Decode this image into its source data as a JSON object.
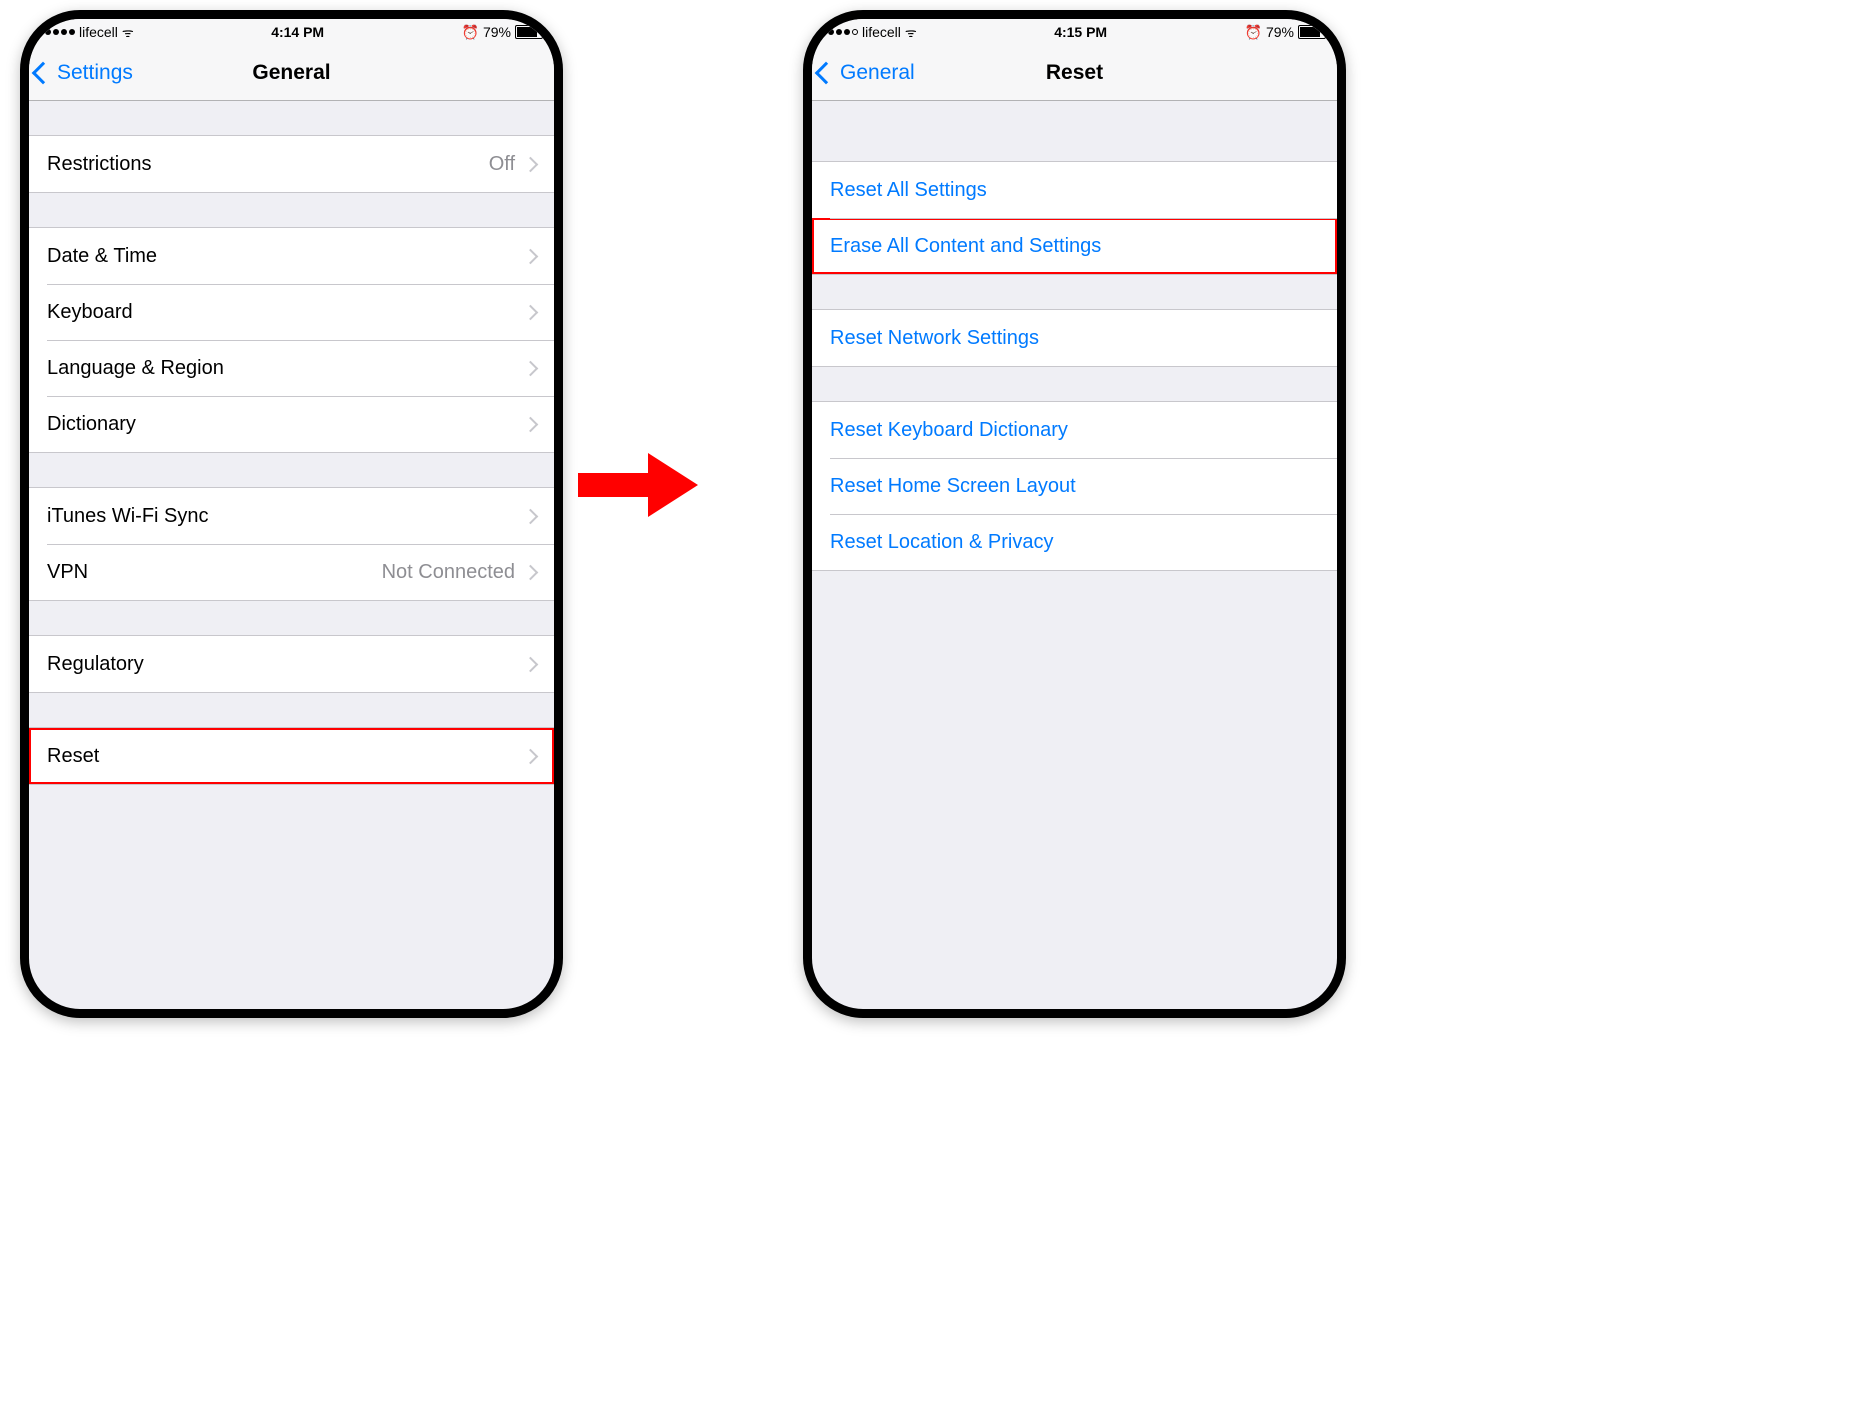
{
  "left": {
    "status": {
      "carrier": "lifecell",
      "time": "4:14 PM",
      "battery": "79%"
    },
    "nav": {
      "back": "Settings",
      "title": "General"
    },
    "g1": [
      {
        "label": "Restrictions",
        "value": "Off"
      }
    ],
    "g2": [
      {
        "label": "Date & Time"
      },
      {
        "label": "Keyboard"
      },
      {
        "label": "Language & Region"
      },
      {
        "label": "Dictionary"
      }
    ],
    "g3": [
      {
        "label": "iTunes Wi-Fi Sync"
      },
      {
        "label": "VPN",
        "value": "Not Connected"
      }
    ],
    "g4": [
      {
        "label": "Regulatory"
      }
    ],
    "g5": [
      {
        "label": "Reset",
        "highlight": true
      }
    ]
  },
  "right": {
    "status": {
      "carrier": "lifecell",
      "time": "4:15 PM",
      "battery": "79%"
    },
    "nav": {
      "back": "General",
      "title": "Reset"
    },
    "g1": [
      {
        "label": "Reset All Settings"
      },
      {
        "label": "Erase All Content and Settings",
        "highlight": true
      }
    ],
    "g2": [
      {
        "label": "Reset Network Settings"
      }
    ],
    "g3": [
      {
        "label": "Reset Keyboard Dictionary"
      },
      {
        "label": "Reset Home Screen Layout"
      },
      {
        "label": "Reset Location & Privacy"
      }
    ]
  },
  "icons": {
    "alarm": "⏰",
    "wifi": "ᯤ"
  }
}
